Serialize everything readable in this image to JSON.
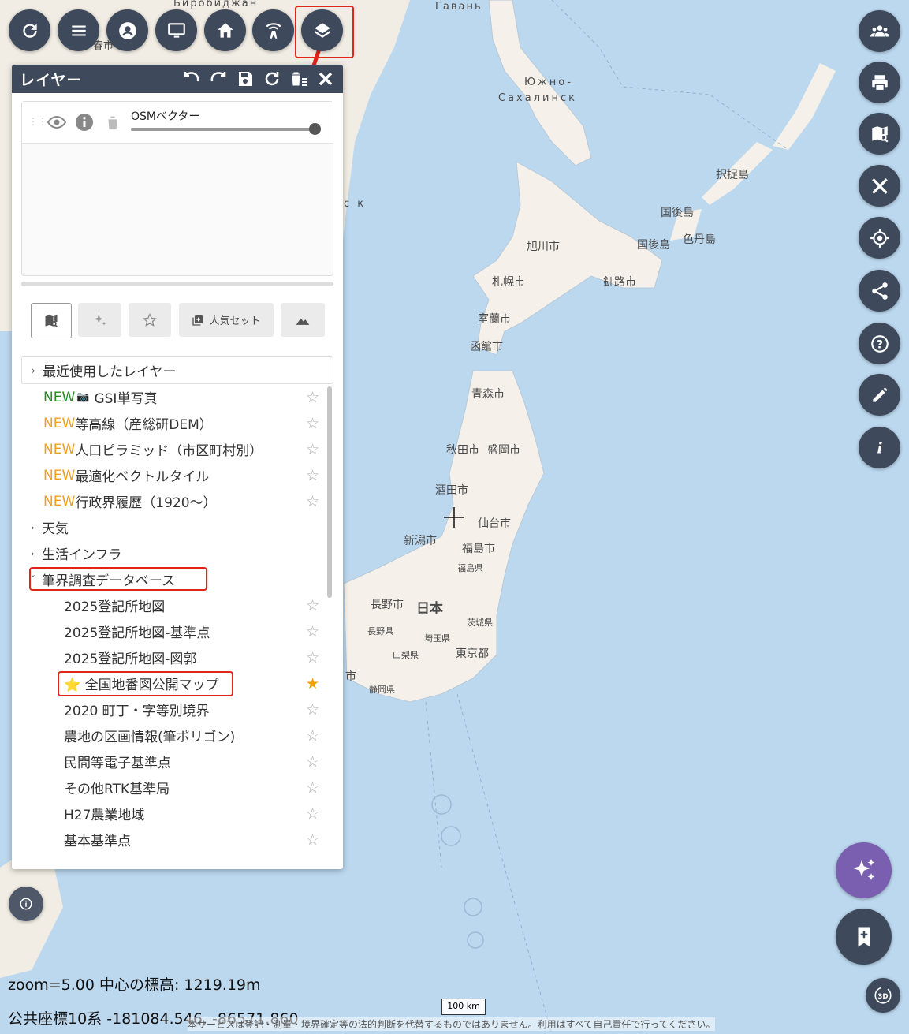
{
  "map": {
    "places": [
      {
        "text": "Гавань"
      },
      {
        "text": "Биробиджан"
      },
      {
        "text": "Южно-"
      },
      {
        "text": "Сахалинск"
      },
      {
        "text": "春市"
      },
      {
        "text": "択捉島"
      },
      {
        "text": "国後島"
      },
      {
        "text": "国後島"
      },
      {
        "text": "色丹島"
      },
      {
        "text": "旭川市"
      },
      {
        "text": "札幌市"
      },
      {
        "text": "釧路市"
      },
      {
        "text": "室蘭市"
      },
      {
        "text": "函館市"
      },
      {
        "text": "青森市"
      },
      {
        "text": "秋田市"
      },
      {
        "text": "盛岡市"
      },
      {
        "text": "酒田市"
      },
      {
        "text": "仙台市"
      },
      {
        "text": "新潟市"
      },
      {
        "text": "福島市"
      },
      {
        "text": "福島県"
      },
      {
        "text": "長野市"
      },
      {
        "text": "日本"
      },
      {
        "text": "茨城県"
      },
      {
        "text": "長野県"
      },
      {
        "text": "埼玉県"
      },
      {
        "text": "山梨県"
      },
      {
        "text": "東京都"
      },
      {
        "text": "静岡県"
      },
      {
        "text": "市"
      },
      {
        "text": "с к"
      }
    ]
  },
  "toolbar": {
    "top_buttons": [
      "refresh-icon",
      "menu-icon",
      "account-icon",
      "monitor-icon",
      "home-icon",
      "signal-tower-icon",
      "layers-icon"
    ],
    "right_buttons": [
      "people-icon",
      "print-icon",
      "map-search-icon",
      "tools-icon",
      "location-icon",
      "share-icon",
      "help-icon",
      "edit-icon",
      "info-icon"
    ]
  },
  "panel": {
    "title": "レイヤー",
    "active_layer": {
      "name": "OSMベクター"
    },
    "popular_set_label": "人気セット",
    "recent_label": "最近使用したレイヤー",
    "new_items": [
      {
        "badge": "NEW",
        "icon": "📷",
        "label": "GSI単写真"
      },
      {
        "badge": "NEW",
        "label": "等高線（産総研DEM）"
      },
      {
        "badge": "NEW",
        "label": "人口ピラミッド（市区町村別）"
      },
      {
        "badge": "NEW",
        "label": "最適化ベクトルタイル"
      },
      {
        "badge": "NEW",
        "label": "行政界履歴（1920〜）"
      }
    ],
    "categories": [
      {
        "label": "天気"
      },
      {
        "label": "生活インフラ"
      },
      {
        "label": "筆界調査データベース"
      }
    ],
    "sub_items": [
      {
        "label": "2025登記所地図",
        "starred": false
      },
      {
        "label": "2025登記所地図-基準点",
        "starred": false
      },
      {
        "label": "2025登記所地図-図郭",
        "starred": false
      },
      {
        "label": "⭐ 全国地番図公開マップ",
        "starred": true
      },
      {
        "label": "2020 町丁・字等別境界",
        "starred": false
      },
      {
        "label": "農地の区画情報(筆ポリゴン)",
        "starred": false
      },
      {
        "label": "民間等電子基準点",
        "starred": false
      },
      {
        "label": "その他RTK基準局",
        "starred": false
      },
      {
        "label": "H27農業地域",
        "starred": false
      },
      {
        "label": "基本基準点",
        "starred": false
      }
    ]
  },
  "status": {
    "zoom_text": "zoom=5.00 中心の標高: 1219.19m",
    "coord_text": "公共座標10系 -181084.546, -86571.860",
    "scale": "100 km",
    "disclaimer": "本サービスは登記・測量・境界確定等の法的判断を代替するものではありません。利用はすべて自己責任で行ってください。",
    "three_d": "3D"
  },
  "colors": {
    "button": "#3e4a5c",
    "ai_button": "#7a5fb0",
    "highlight": "#e0251b",
    "land": "#f5f1ea",
    "sea": "#bcd8ef"
  }
}
